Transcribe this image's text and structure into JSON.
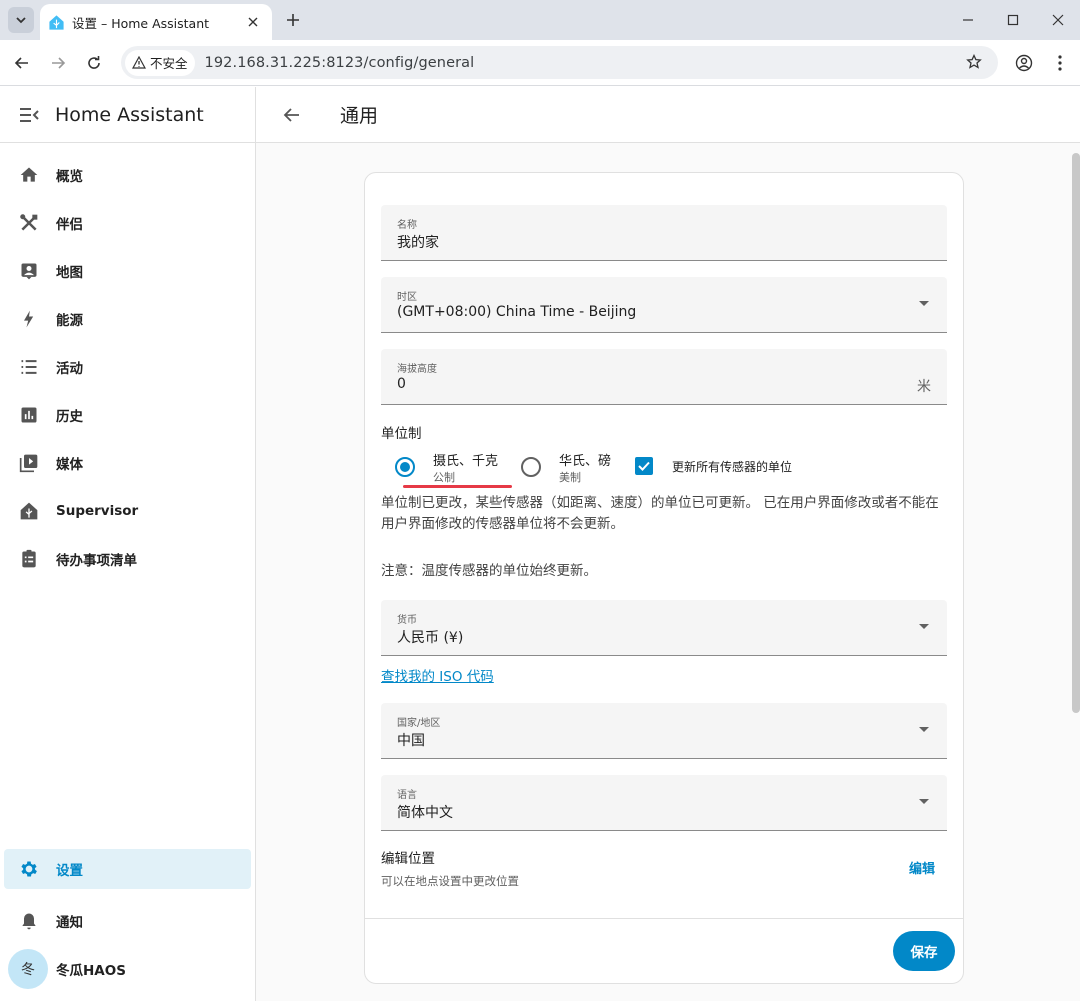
{
  "browser": {
    "tab_title": "设置 – Home Assistant",
    "security_label": "不安全",
    "url": "192.168.31.225:8123/config/general"
  },
  "sidebar": {
    "title": "Home Assistant",
    "items": [
      {
        "label": "概览",
        "icon": "home-icon"
      },
      {
        "label": "伴侣",
        "icon": "tools-icon"
      },
      {
        "label": "地图",
        "icon": "map-account-icon"
      },
      {
        "label": "能源",
        "icon": "lightning-icon"
      },
      {
        "label": "活动",
        "icon": "list-icon"
      },
      {
        "label": "历史",
        "icon": "chart-box-icon"
      },
      {
        "label": "媒体",
        "icon": "play-box-icon"
      },
      {
        "label": "Supervisor",
        "icon": "home-assistant-icon"
      },
      {
        "label": "待办事项清单",
        "icon": "clipboard-list-icon"
      }
    ],
    "settings_label": "设置",
    "notifications_label": "通知",
    "user_initial": "冬",
    "user_name": "冬瓜HAOS"
  },
  "page": {
    "title": "通用"
  },
  "form": {
    "name": {
      "label": "名称",
      "value": "我的家"
    },
    "timezone": {
      "label": "时区",
      "value": "(GMT+08:00) China Time - Beijing"
    },
    "elevation": {
      "label": "海拔高度",
      "value": "0",
      "unit": "米"
    },
    "unit_system": {
      "label": "单位制",
      "metric_main": "摄氏、千克",
      "metric_sub": "公制",
      "imperial_main": "华氏、磅",
      "imperial_sub": "美制",
      "selected": "metric",
      "update_sensors_label": "更新所有传感器的单位",
      "update_sensors_checked": true
    },
    "unit_note_1": "单位制已更改，某些传感器（如距离、速度）的单位已可更新。 已在用户界面修改或者不能在用户界面修改的传感器单位将不会更新。",
    "unit_note_2": "注意：温度传感器的单位始终更新。",
    "currency": {
      "label": "货币",
      "value": "人民币 (¥)"
    },
    "iso_link": "查找我的 ISO 代码",
    "country": {
      "label": "国家/地区",
      "value": "中国"
    },
    "language": {
      "label": "语言",
      "value": "简体中文"
    },
    "location": {
      "title": "编辑位置",
      "subtitle": "可以在地点设置中更改位置",
      "edit_label": "编辑"
    },
    "save_label": "保存"
  },
  "colors": {
    "accent": "#0288c8",
    "active_bg": "#e1f1f8",
    "annotation": "#e63946"
  }
}
